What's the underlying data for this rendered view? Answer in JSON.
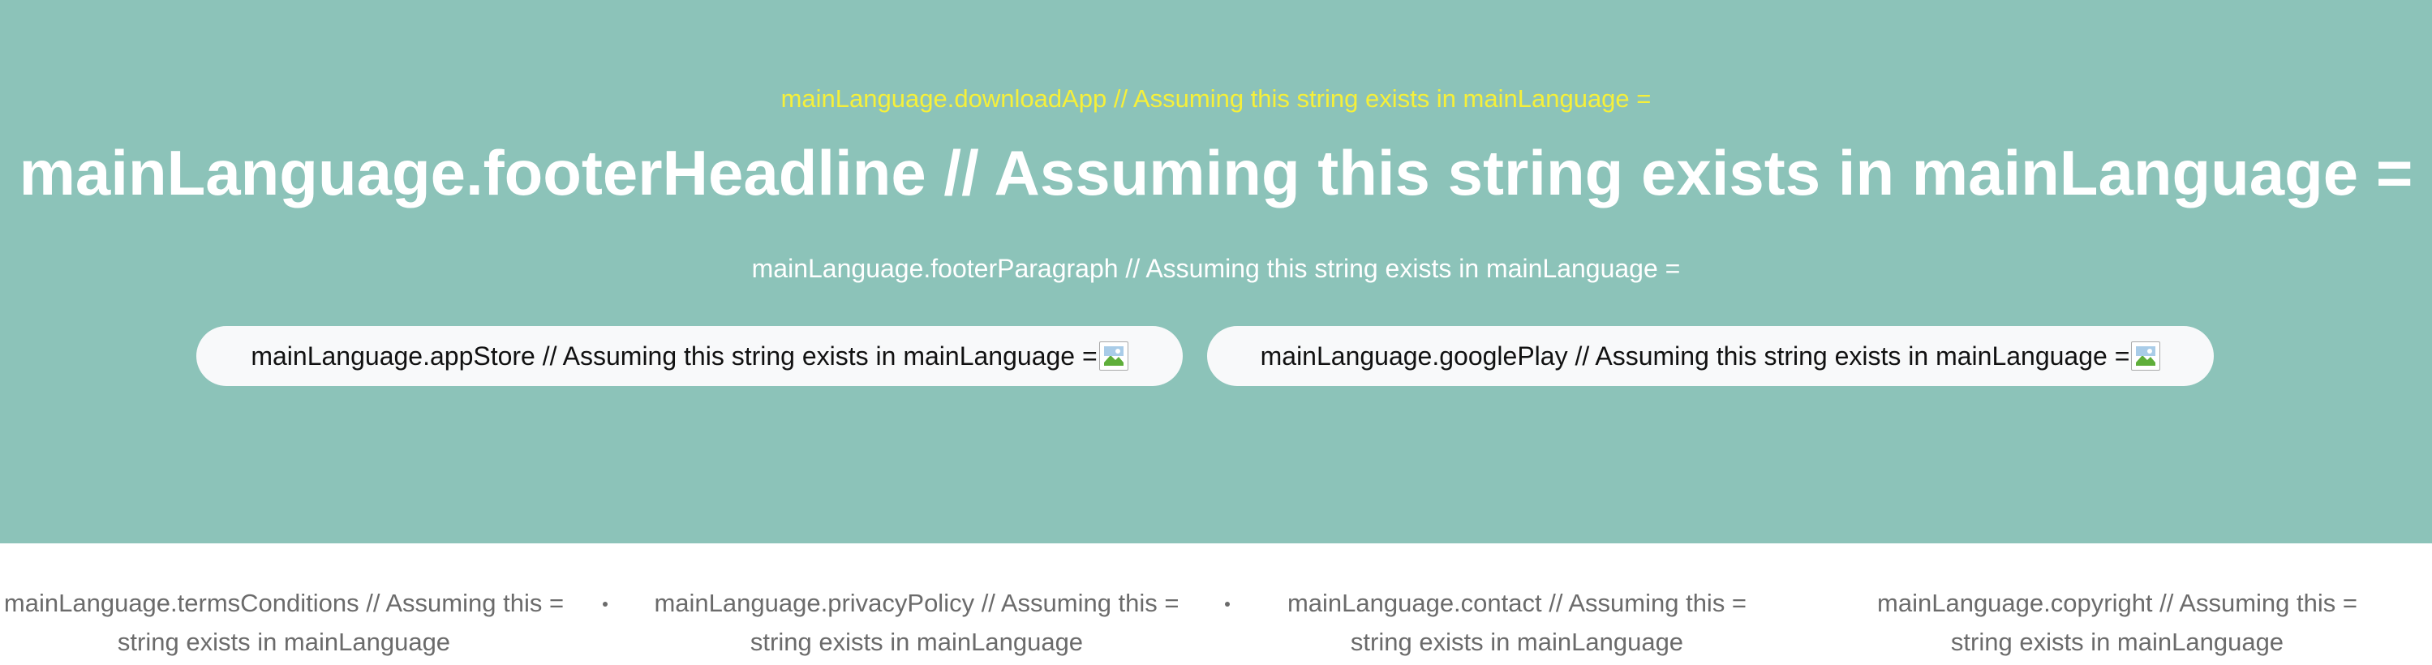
{
  "hero": {
    "download_app": "mainLanguage.downloadApp // Assuming this string exists in mainLanguage =",
    "headline": "mainLanguage.footerHeadline // Assuming this string exists in mainLanguage =",
    "paragraph": "mainLanguage.footerParagraph // Assuming this string exists in mainLanguage =",
    "app_store_label": "mainLanguage.appStore // Assuming this string exists in mainLanguage =",
    "google_play_label": "mainLanguage.googlePlay // Assuming this string exists in mainLanguage ="
  },
  "footer": {
    "links": [
      {
        "line1": "mainLanguage.termsConditions // Assuming this =",
        "line2": "string exists in mainLanguage"
      },
      {
        "line1": "mainLanguage.privacyPolicy // Assuming this =",
        "line2": "string exists in mainLanguage"
      },
      {
        "line1": "mainLanguage.contact // Assuming this =",
        "line2": "string exists in mainLanguage"
      },
      {
        "line1": "mainLanguage.copyright // Assuming this =",
        "line2": "string exists in mainLanguage"
      }
    ]
  },
  "colors": {
    "hero_bg": "#8cc3b9",
    "accent_yellow": "#f6f03a",
    "footer_text": "#6b6b6b"
  },
  "icons": {
    "store_badge": "broken-image-icon"
  }
}
